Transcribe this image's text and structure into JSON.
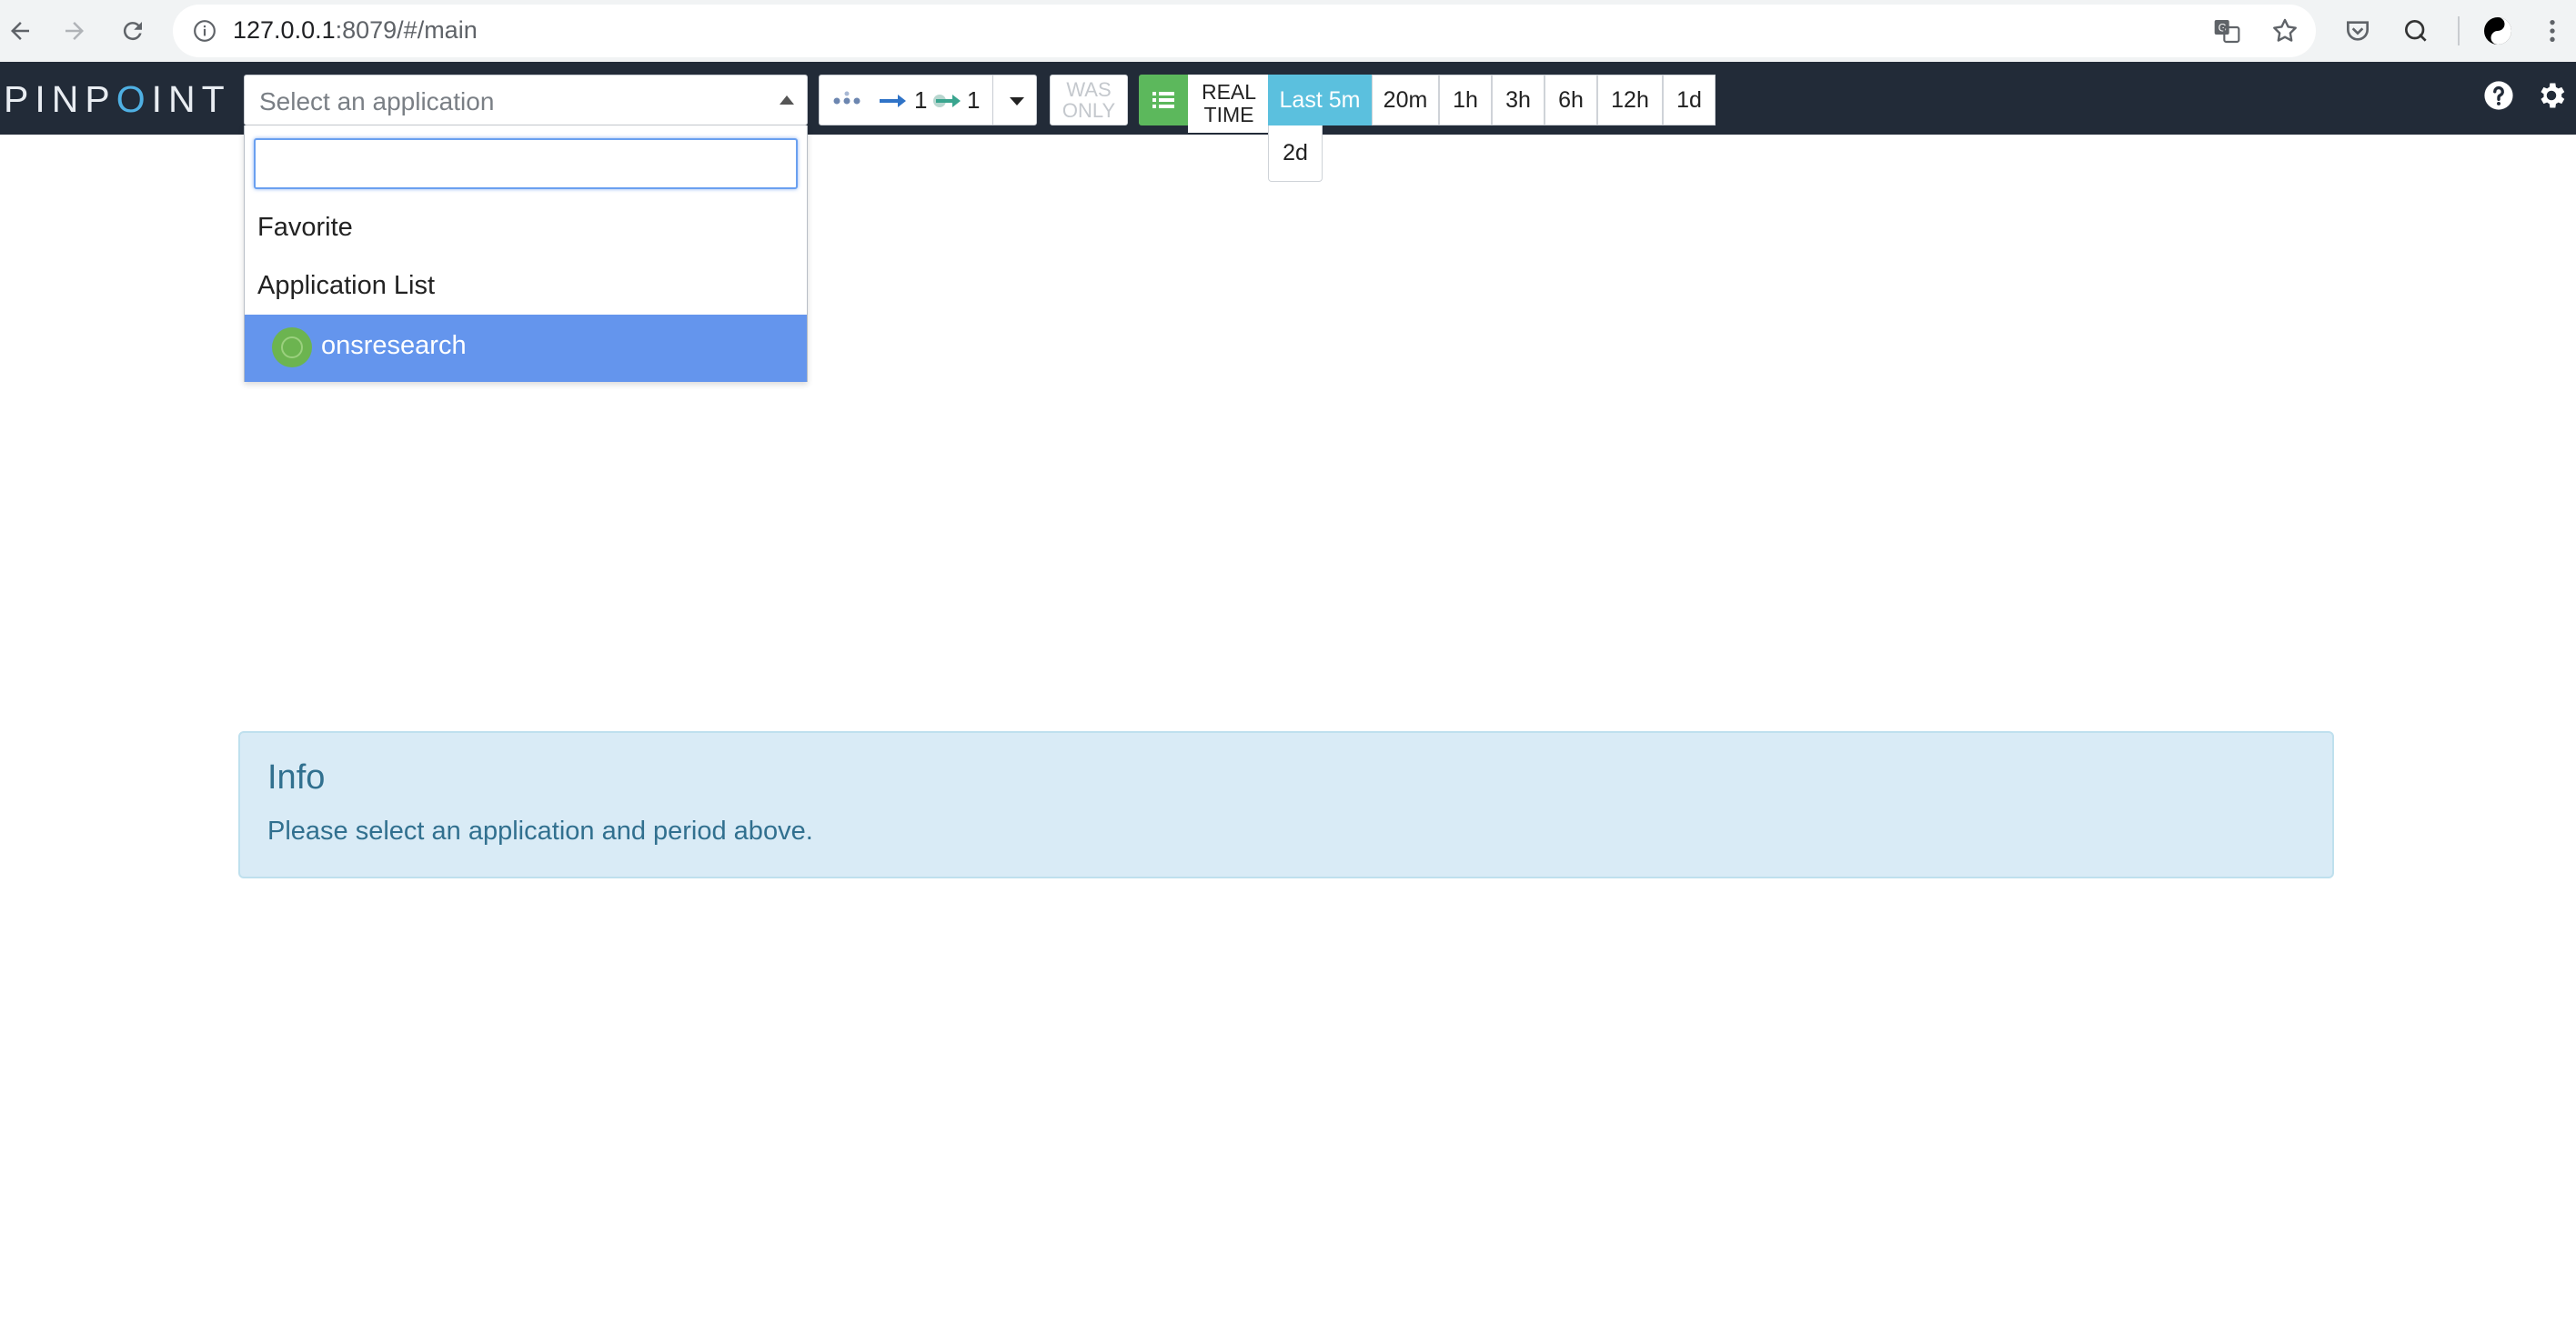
{
  "browser": {
    "url_host": "127.0.0.1",
    "url_rest": ":8079/#/main",
    "profile_badge": "0"
  },
  "app": {
    "logo_prefix": "PINP",
    "logo_o": "O",
    "logo_suffix": "INT",
    "select_placeholder": "Select an application",
    "dropdown": {
      "search_value": "",
      "group_favorite": "Favorite",
      "group_app_list": "Application List",
      "items": [
        {
          "label": "onsresearch",
          "icon": "app-status-icon",
          "selected": true
        }
      ]
    },
    "depth": {
      "inbound": "1",
      "outbound": "1"
    },
    "was_only": {
      "line1": "WAS",
      "line2": "ONLY"
    },
    "realtime": {
      "line1": "REAL",
      "line2": "TIME"
    },
    "periods": [
      "Last 5m",
      "20m",
      "1h",
      "3h",
      "6h",
      "12h",
      "1d"
    ],
    "active_period": "Last 5m",
    "period_more": "2d"
  },
  "info": {
    "title": "Info",
    "message": "Please select an application and period above."
  },
  "colors": {
    "topbar": "#222b38",
    "accent_blue": "#4fb0e3",
    "selected_item": "#6495ed",
    "active_period": "#5bc0de",
    "list_button": "#5cb85c",
    "info_bg": "#d9ebf6",
    "info_text": "#31708f"
  }
}
